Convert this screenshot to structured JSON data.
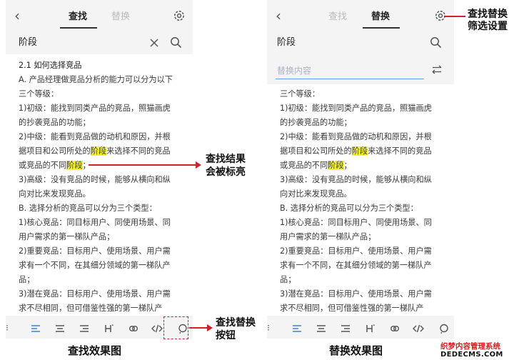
{
  "left_screen": {
    "tabs": [
      "查找",
      "替换"
    ],
    "search_term": "阶段",
    "content": [
      [
        {
          "t": "2.1 如何选择竞品"
        }
      ],
      [
        {
          "t": "A. 产品经理做竞品分析的能力可以分为以下"
        }
      ],
      [
        {
          "t": "三个等级："
        }
      ],
      [
        {
          "t": "1)初级：能找到同类产品的竞品，照猫画虎"
        }
      ],
      [
        {
          "t": "的抄袭竞品的功能；"
        }
      ],
      [
        {
          "t": "2)中级：能看到竞品做的动机和原因，并根"
        }
      ],
      [
        {
          "t": "据项目和公司所处的"
        },
        {
          "t": "阶段",
          "hl": true
        },
        {
          "t": "来选择不同的竞品"
        }
      ],
      [
        {
          "t": "或竞品的不同"
        },
        {
          "t": "阶段",
          "hl": true
        },
        {
          "t": "；"
        }
      ],
      [
        {
          "t": "3)高级：没有竞品的时候，能够从横向和纵"
        }
      ],
      [
        {
          "t": "向对比来发现竞品。"
        }
      ],
      [
        {
          "t": "B. 选择分析的竞品可以分为三个类型："
        }
      ],
      [
        {
          "t": "1)核心竞品：同目标用户、同使用场景、同"
        }
      ],
      [
        {
          "t": "用户需求的第一梯队产品；"
        }
      ],
      [
        {
          "t": "2)重要竞品：目标用户、使用场景、用户需"
        }
      ],
      [
        {
          "t": "求有一个不同，在其细分领域的第一梯队产"
        }
      ],
      [
        {
          "t": "品；"
        }
      ],
      [
        {
          "t": "3)潜在竞品：目标用户、使用场景、用户需"
        }
      ],
      [
        {
          "t": "求不尽相同，但可借鉴性强的第一梯队产"
        }
      ]
    ],
    "caption": "查找效果图"
  },
  "right_screen": {
    "tabs": [
      "查找",
      "替换"
    ],
    "search_term": "阶段",
    "replace_placeholder": "替换内容",
    "content": [
      [
        {
          "t": "三个等级："
        }
      ],
      [
        {
          "t": "1)初级：能找到同类产品的竞品，照猫画虎"
        }
      ],
      [
        {
          "t": "的抄袭竞品的功能；"
        }
      ],
      [
        {
          "t": "2)中级：能看到竞品做的动机和原因，并根"
        }
      ],
      [
        {
          "t": "据项目和公司所处的"
        },
        {
          "t": "阶段",
          "hl": true
        },
        {
          "t": "来选择不同的竞品"
        }
      ],
      [
        {
          "t": "或竞品的不同"
        },
        {
          "t": "阶段",
          "hl": true
        },
        {
          "t": "；"
        }
      ],
      [
        {
          "t": "3)高级：没有竞品的时候，能够从横向和纵"
        }
      ],
      [
        {
          "t": "向对比来发现竞品。"
        }
      ],
      [
        {
          "t": "B. 选择分析的竞品可以分为三个类型："
        }
      ],
      [
        {
          "t": "1)核心竞品：同目标用户、同使用场景、同"
        }
      ],
      [
        {
          "t": "用户需求的第一梯队产品；"
        }
      ],
      [
        {
          "t": "2)重要竞品：目标用户、使用场景、用户需"
        }
      ],
      [
        {
          "t": "求有一个不同，在其细分领域的第一梯队产"
        }
      ],
      [
        {
          "t": "品；"
        }
      ],
      [
        {
          "t": "3)潜在竞品：目标用户、使用场景、用户需"
        }
      ],
      [
        {
          "t": "求不尽相同，但可借鉴性强的第一梯队产"
        }
      ]
    ],
    "caption": "替换效果图"
  },
  "toolbar": [
    "align-left-icon",
    "align-center-icon",
    "align-right-icon",
    "heading-icon",
    "link-icon",
    "code-icon",
    "search-icon"
  ],
  "annotations": {
    "settings": [
      "查找替换",
      "筛选设置"
    ],
    "highlight": [
      "查找结果",
      "会被标亮"
    ],
    "button": [
      "查找替换",
      "按钮"
    ]
  },
  "watermark": {
    "line1": "织梦内容管理系统",
    "line2": "DEDECMS.COM"
  },
  "colors": {
    "highlight": "#f4f230",
    "accent": "#3b82d8",
    "annotation": "#d0202a"
  }
}
